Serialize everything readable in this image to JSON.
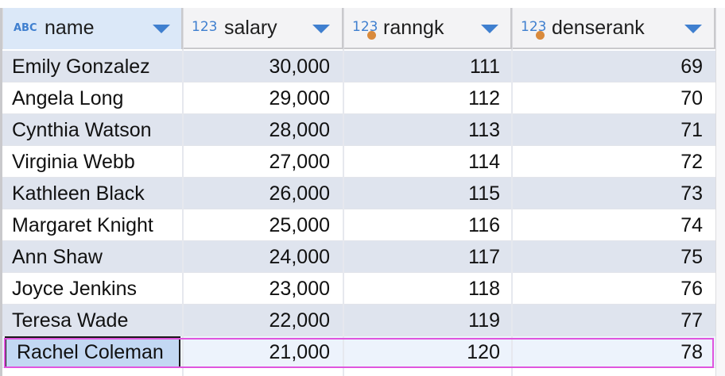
{
  "columns": [
    {
      "type_badge": "ABC",
      "label": "name",
      "has_key_dot": false
    },
    {
      "type_badge": "123",
      "label": "salary",
      "has_key_dot": false
    },
    {
      "type_badge": "123",
      "label": "ranngk",
      "has_key_dot": true
    },
    {
      "type_badge": "123",
      "label": "denserank",
      "has_key_dot": true
    }
  ],
  "rows": [
    {
      "name": "Emily Gonzalez",
      "salary": "30,000",
      "ranngk": "111",
      "denserank": "69"
    },
    {
      "name": "Angela Long",
      "salary": "29,000",
      "ranngk": "112",
      "denserank": "70"
    },
    {
      "name": "Cynthia Watson",
      "salary": "28,000",
      "ranngk": "113",
      "denserank": "71"
    },
    {
      "name": "Virginia Webb",
      "salary": "27,000",
      "ranngk": "114",
      "denserank": "72"
    },
    {
      "name": "Kathleen Black",
      "salary": "26,000",
      "ranngk": "115",
      "denserank": "73"
    },
    {
      "name": "Margaret Knight",
      "salary": "25,000",
      "ranngk": "116",
      "denserank": "74"
    },
    {
      "name": "Ann Shaw",
      "salary": "24,000",
      "ranngk": "117",
      "denserank": "75"
    },
    {
      "name": "Joyce Jenkins",
      "salary": "23,000",
      "ranngk": "118",
      "denserank": "76"
    },
    {
      "name": "Teresa Wade",
      "salary": "22,000",
      "ranngk": "119",
      "denserank": "77"
    },
    {
      "name": "Rachel Coleman",
      "salary": "21,000",
      "ranngk": "120",
      "denserank": "78"
    }
  ],
  "selected_row_index": 9,
  "colors": {
    "type_badge": "#3f7fcf",
    "key_dot": "#d98a3c",
    "stripe": "#dfe4ee",
    "selection_outline": "#e055de",
    "current_cell": "#c3d8f3"
  }
}
